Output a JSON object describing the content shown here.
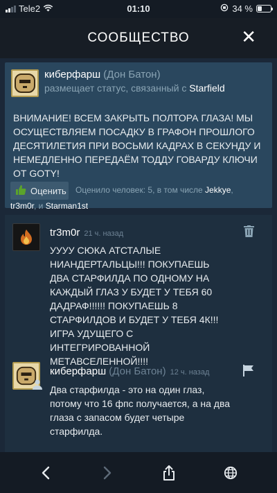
{
  "status_bar": {
    "carrier": "Tele2",
    "time": "01:10",
    "battery": "34 %",
    "battery_level": 0.34
  },
  "header": {
    "title": "СООБЩЕСТВО",
    "close_glyph": "✕"
  },
  "post": {
    "author": "киберфарш",
    "nickname": "(Дон Батон)",
    "subtitle_prefix": "размещает статус, связанный с",
    "game": "Starfield",
    "body": "ВНИМАНИЕ! ВСЕМ ЗАКРЫТЬ ПОЛТОРА ГЛАЗА! МЫ ОСУЩЕСТВЛЯЕМ ПОСАДКУ В ГРАФОН ПРОШЛОГО ДЕСЯТИЛЕТИЯ ПРИ ВОСЬМИ КАДРАХ В СЕКУНДУ И НЕМЕДЛЕННО ПЕРЕДАЁМ ТОДДУ ГОВАРДУ КЛЮЧИ ОТ GOTY!",
    "rate_label": "Оценить",
    "rated_prefix": "Оценило человек: 5, в том числе",
    "rated_user_1": "Jekkye",
    "rated_user_2": "tr3m0r",
    "rated_and": ", и",
    "rated_user_3": "Starman1st",
    "comma": ","
  },
  "comments": [
    {
      "author": "tr3m0r",
      "time": "21 ч. назад",
      "text": "УУУУ СЮКА АТСТАЛЫЕ НИАНДЕРТАЛЬЦЫ!!! ПОКУПАЕШЬ ДВА СТАРФИЛДА ПО ОДНОМУ НА КАЖДЫЙ ГЛАЗ У БУДЕТ У ТЕБЯ 60 ДАДРАФ!!!!!! ПОКУПАЕШЬ 8 СТАРФИЛДОВ И БУДЕТ У ТЕБЯ 4К!!! ИГРА УДУЩЕГО С ИНТЕГРИРОВАННОЙ МЕТАВСЕЛЕННОЙ!!!!"
    },
    {
      "author": "киберфарш",
      "nickname": "(Дон Батон)",
      "time": "12 ч. назад",
      "text": "Два старфилда - это на один глаз, потому что 16 фпс получается, а на два глаза с запасом будет четыре старфилда."
    }
  ],
  "icons": {
    "delete": "trash-icon",
    "report": "flag-icon",
    "rate": "thumbs-up-icon",
    "back": "chevron-left-icon",
    "forward": "chevron-right-icon",
    "share": "share-icon",
    "browser": "globe-icon"
  },
  "colors": {
    "background": "#1b2838",
    "post_card": "#2a475e",
    "accent_green": "#5ba32b"
  }
}
